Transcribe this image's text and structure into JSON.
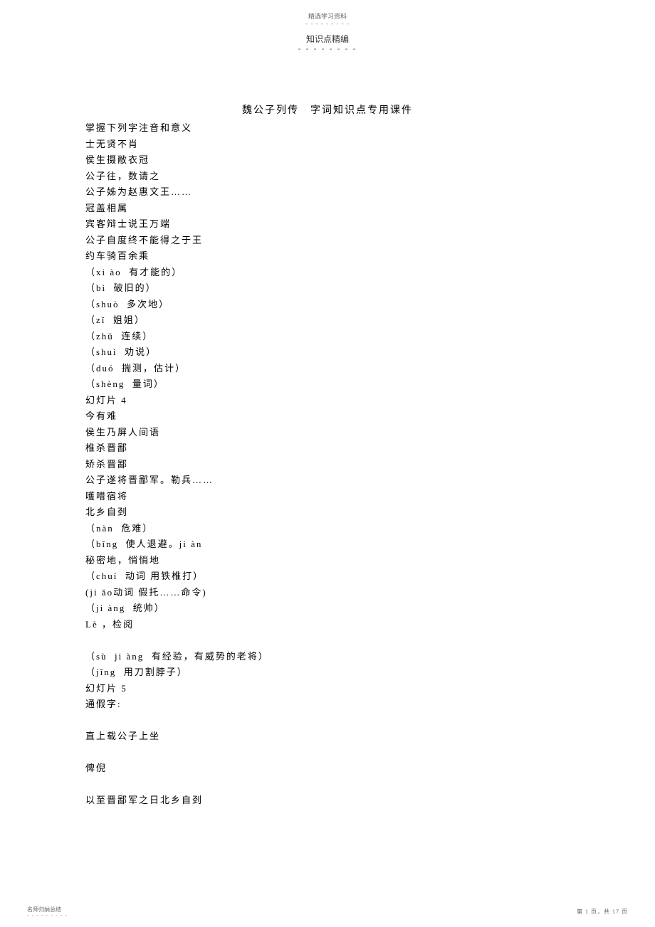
{
  "header": {
    "top": "精选学习资料",
    "top_dashes": "- - - - - - - - -",
    "sub": "知识点精编",
    "sub_dashes": "- - - - - - - -"
  },
  "title": "魏公子列传　字词知识点专用课件",
  "lines": [
    "掌握下列字注音和意义",
    "士无贤不肖",
    "侯生摄敝衣冠",
    "公子往，数请之",
    "公子姊为赵惠文王……",
    "冠盖相属",
    "宾客辩士说王万端",
    "公子自度终不能得之于王",
    "约车骑百余乘",
    "（xi ào  有才能的）",
    "（bì  破旧的）",
    "（shuò  多次地）",
    "（zǐ  姐姐）",
    "（zhǔ  连续）",
    "（shuì  劝说）",
    "（duó  揣测，估计）",
    "（shèng  量词）",
    "幻灯片 4",
    "今有难",
    "侯生乃屏人间语",
    "椎杀晋鄙",
    "矫杀晋鄙",
    "公子遂将晋鄙军。勒兵……",
    "嚄唶宿将",
    "北乡自刭",
    "（nàn  危难）",
    "（bǐng  使人退避。ji àn",
    "秘密地，悄悄地",
    "（chuí  动词 用铁椎打）",
    "(ji ǎo动词 假托……命令)",
    "（ji àng  统帅）",
    "Lè ，检阅",
    "",
    "（sù  ji àng  有经验，有威势的老将）",
    "（jǐng  用刀割脖子）",
    "幻灯片 5",
    "通假字:",
    "",
    "直上载公子上坐",
    "",
    "俾倪",
    "",
    "以至晋鄙军之日北乡自刭"
  ],
  "footer": {
    "left": "名师归纳总结",
    "left_dashes": "- - - - - - - - -",
    "right": "第 1 页，共 17 页"
  }
}
